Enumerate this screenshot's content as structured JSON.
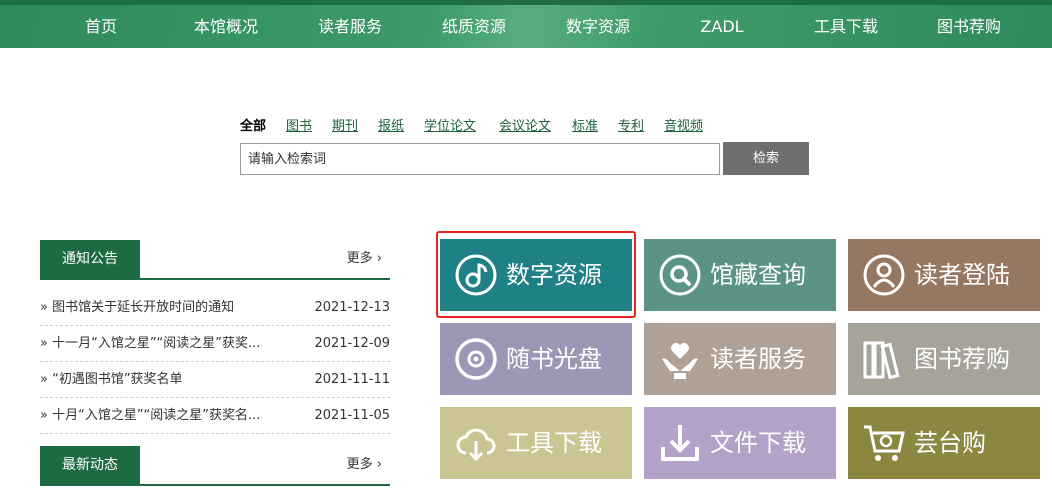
{
  "nav": {
    "items": [
      "首页",
      "本馆概况",
      "读者服务",
      "纸质资源",
      "数字资源",
      "ZADL",
      "工具下载",
      "图书荐购"
    ]
  },
  "search": {
    "tabs": [
      "全部",
      "图书",
      "期刊",
      "报纸",
      "学位论文",
      "会议论文",
      "标准",
      "专利",
      "音视频"
    ],
    "active_tab": "全部",
    "placeholder": "请输入检索词",
    "button": "检索"
  },
  "notices": {
    "title": "通知公告",
    "more": "更多 ›",
    "items": [
      {
        "title": "» 图书馆关于延长开放时间的通知",
        "date": "2021-12-13"
      },
      {
        "title": "» 十一月“入馆之星”“阅读之星”获奖...",
        "date": "2021-12-09"
      },
      {
        "title": "» “初遇图书馆”获奖名单",
        "date": "2021-11-11"
      },
      {
        "title": "» 十月“入馆之星”“阅读之星”获奖名...",
        "date": "2021-11-05"
      }
    ]
  },
  "news": {
    "title": "最新动态",
    "more": "更多 ›"
  },
  "tiles": [
    {
      "label": "数字资源",
      "icon": "disc-note-icon",
      "color": "#1f8085"
    },
    {
      "label": "馆藏查询",
      "icon": "search-circle-icon",
      "color": "#5b9486"
    },
    {
      "label": "读者登陆",
      "icon": "user-circle-icon",
      "color": "#967762"
    },
    {
      "label": "随书光盘",
      "icon": "cd-icon",
      "color": "#9b98b6"
    },
    {
      "label": "读者服务",
      "icon": "heart-hand-icon",
      "color": "#afa196"
    },
    {
      "label": "图书荐购",
      "icon": "books-icon",
      "color": "#a6a399"
    },
    {
      "label": "工具下载",
      "icon": "cloud-download-icon",
      "color": "#cbc493"
    },
    {
      "label": "文件下载",
      "icon": "download-tray-icon",
      "color": "#b4a1c7"
    },
    {
      "label": "芸台购",
      "icon": "cart-icon",
      "color": "#8b8640"
    }
  ]
}
